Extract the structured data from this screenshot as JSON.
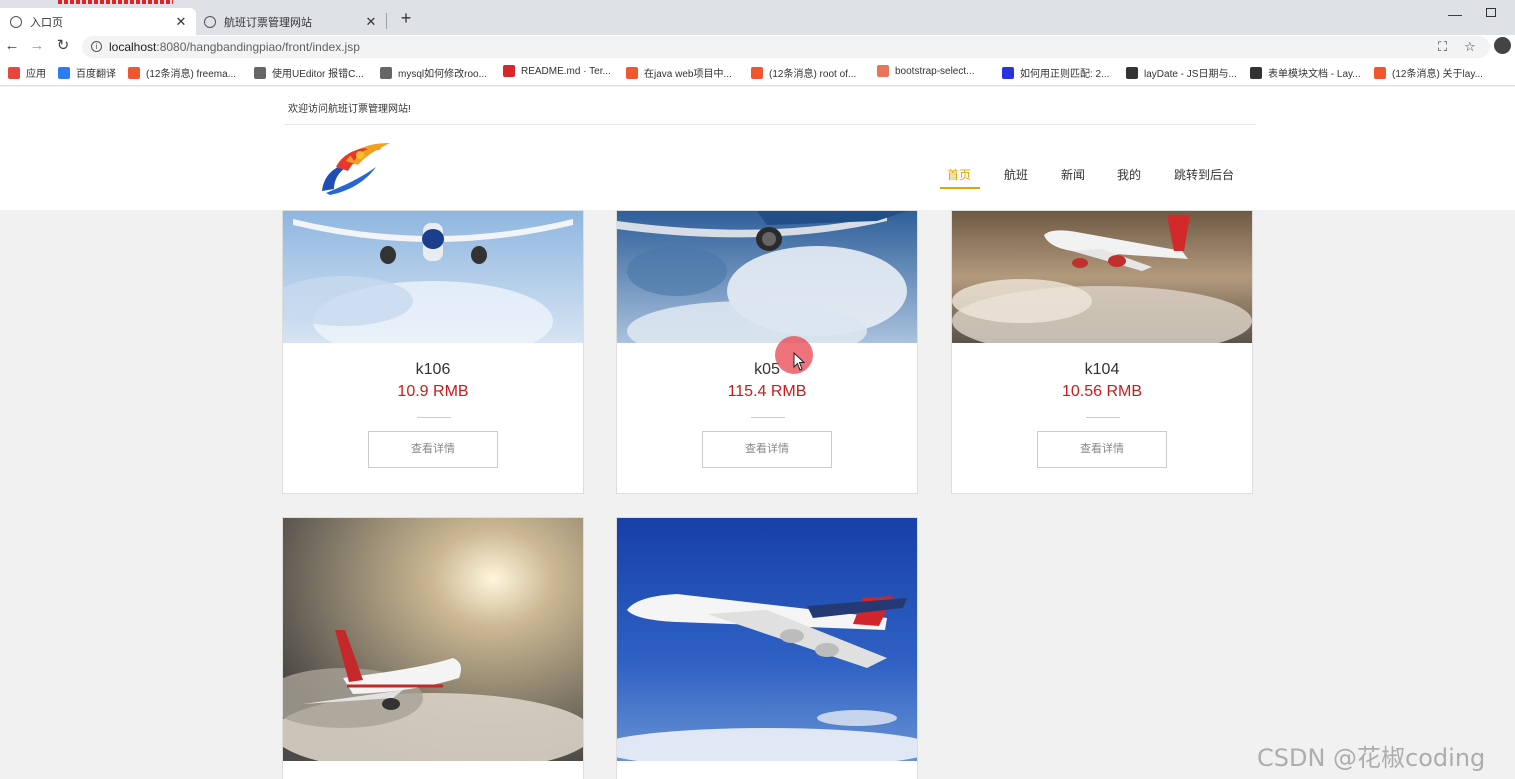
{
  "browser": {
    "tabs": [
      {
        "title": "入口页",
        "active": true
      },
      {
        "title": "航班订票管理网站",
        "active": false
      }
    ],
    "new_tab_symbol": "+",
    "close_symbol": "✕",
    "url_host": "localhost",
    "url_path": ":8080/hangbandingpiao/front/index.jsp",
    "bookmarks": [
      {
        "label": "应用",
        "icon": "apps-grid-icon",
        "color": "#e8453c"
      },
      {
        "label": "百度翻译",
        "icon": "translate-icon",
        "color": "#2d7cf6"
      },
      {
        "label": "(12条消息) freema...",
        "icon": "csdn-icon",
        "color": "#f0572f"
      },
      {
        "label": "使用UEditor 报错C...",
        "icon": "script-icon",
        "color": "#666666"
      },
      {
        "label": "mysql如何修改roo...",
        "icon": "script-icon",
        "color": "#666666"
      },
      {
        "label": "README.md · Ter...",
        "icon": "gitee-icon",
        "color": "#d9262b"
      },
      {
        "label": "在java web项目中...",
        "icon": "csdn-icon",
        "color": "#f0572f"
      },
      {
        "label": "(12条消息) root of...",
        "icon": "csdn-icon",
        "color": "#f0572f"
      },
      {
        "label": "bootstrap-select...",
        "icon": "jianshu-icon",
        "color": "#e9745a"
      },
      {
        "label": "如何用正则匹配: 2...",
        "icon": "baidu-icon",
        "color": "#2932e1"
      },
      {
        "label": "layDate - JS日期与...",
        "icon": "layui-icon",
        "color": "#333333"
      },
      {
        "label": "表单模块文档 - Lay...",
        "icon": "layui-icon",
        "color": "#333333"
      },
      {
        "label": "(12条消息) 关于lay...",
        "icon": "csdn-icon",
        "color": "#f0572f"
      }
    ]
  },
  "site": {
    "welcome": "欢迎访问航班订票管理网站!",
    "nav": [
      "首页",
      "航班",
      "新闻",
      "我的",
      "跳转到后台"
    ],
    "active_nav": "首页",
    "accent_color": "#e4a400",
    "price_color": "#cc1a1a"
  },
  "flights": [
    {
      "name": "k106",
      "price": "10.9 RMB",
      "button": "查看详情"
    },
    {
      "name": "k05",
      "price": "115.4 RMB",
      "button": "查看详情"
    },
    {
      "name": "k104",
      "price": "10.56 RMB",
      "button": "查看详情"
    },
    {
      "name": "",
      "price": "",
      "button": ""
    },
    {
      "name": "",
      "price": "",
      "button": ""
    }
  ],
  "watermark": "CSDN @花椒coding"
}
